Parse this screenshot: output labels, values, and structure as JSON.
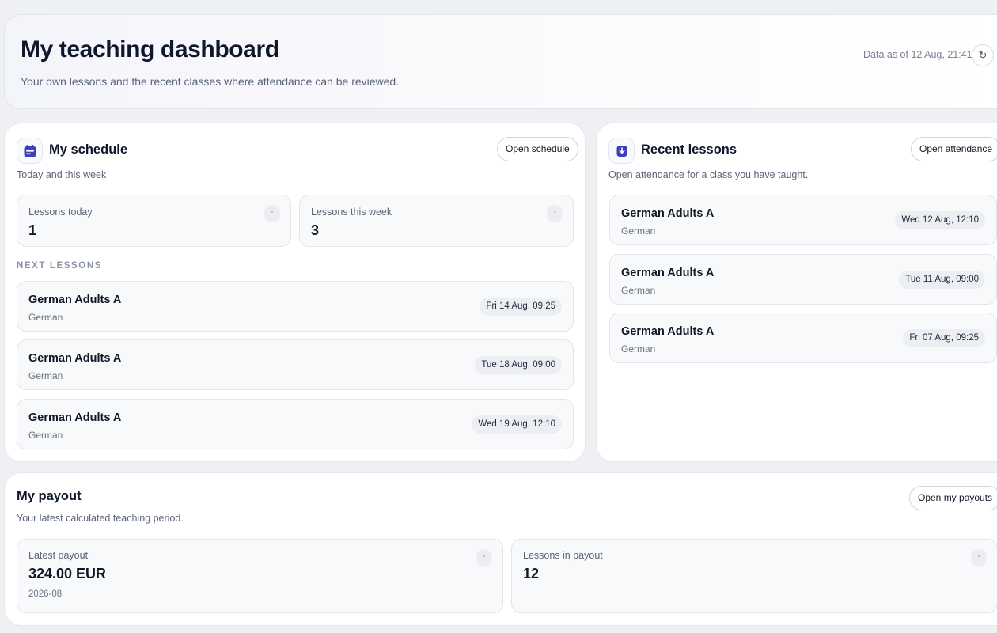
{
  "header": {
    "title": "My teaching dashboard",
    "subtitle": "Your own lessons and the recent classes where attendance can be reviewed.",
    "data_as_of": "Data as of 12 Aug, 21:41",
    "refresh_icon": "↻"
  },
  "schedule": {
    "title": "My schedule",
    "subtitle": "Today and this week",
    "open_label": "Open schedule",
    "icon": "calendar-icon",
    "stats": [
      {
        "label": "Lessons today",
        "value": "1",
        "badge": "·"
      },
      {
        "label": "Lessons this week",
        "value": "3",
        "badge": "·"
      }
    ],
    "next_label": "NEXT LESSONS",
    "lessons": [
      {
        "name": "German Adults A",
        "language": "German",
        "date": "Fri 14 Aug, 09:25"
      },
      {
        "name": "German Adults A",
        "language": "German",
        "date": "Tue 18 Aug, 09:00"
      },
      {
        "name": "German Adults A",
        "language": "German",
        "date": "Wed 19 Aug, 12:10"
      }
    ]
  },
  "recent": {
    "title": "Recent lessons",
    "subtitle": "Open attendance for a class you have taught.",
    "open_label": "Open attendance",
    "icon": "attendance-icon",
    "lessons": [
      {
        "name": "German Adults A",
        "language": "German",
        "date": "Wed 12 Aug, 12:10"
      },
      {
        "name": "German Adults A",
        "language": "German",
        "date": "Tue 11 Aug, 09:00"
      },
      {
        "name": "German Adults A",
        "language": "German",
        "date": "Fri 07 Aug, 09:25"
      }
    ]
  },
  "payout": {
    "title": "My payout",
    "subtitle": "Your latest calculated teaching period.",
    "open_label": "Open my payouts",
    "latest": {
      "label": "Latest payout",
      "value": "324.00 EUR",
      "period": "2026-08",
      "badge": "·"
    },
    "lessons": {
      "label": "Lessons in payout",
      "value": "12",
      "badge": "·"
    }
  },
  "colors": {
    "accent": "#3b3fb8",
    "background": "#eff0f3",
    "card": "#f8f9fb"
  }
}
